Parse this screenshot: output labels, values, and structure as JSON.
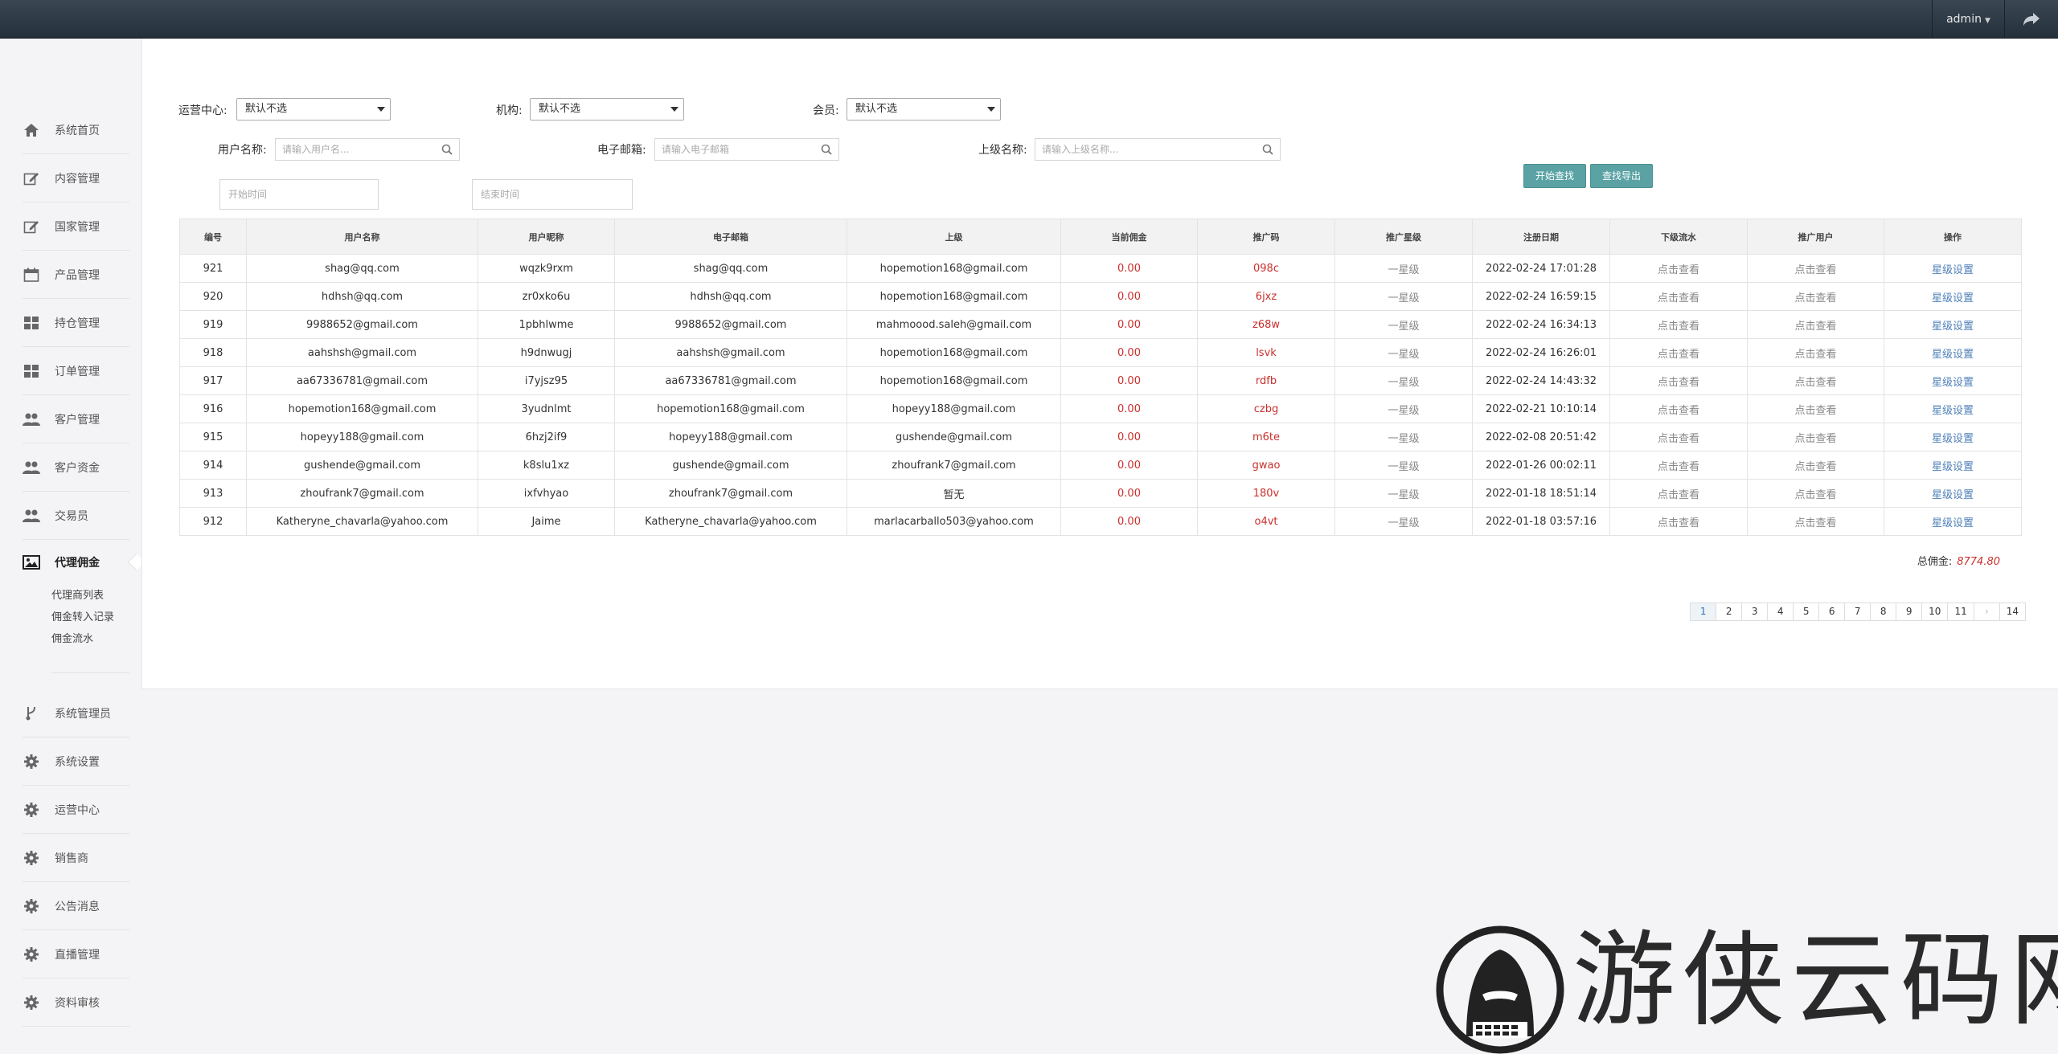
{
  "topbar": {
    "user": "admin"
  },
  "sidebar": {
    "items": [
      {
        "label": "系统首页",
        "icon": "home-icon"
      },
      {
        "label": "内容管理",
        "icon": "edit-icon"
      },
      {
        "label": "国家管理",
        "icon": "edit-icon"
      },
      {
        "label": "产品管理",
        "icon": "calendar-icon"
      },
      {
        "label": "持仓管理",
        "icon": "grid-icon"
      },
      {
        "label": "订单管理",
        "icon": "grid-icon"
      },
      {
        "label": "客户管理",
        "icon": "users-icon"
      },
      {
        "label": "客户资金",
        "icon": "users-icon"
      },
      {
        "label": "交易员",
        "icon": "users-icon"
      },
      {
        "label": "代理佣金",
        "icon": "image-icon"
      }
    ],
    "sub_items": [
      "代理商列表",
      "佣金转入记录",
      "佣金流水"
    ],
    "items_after": [
      {
        "label": "系统管理员",
        "icon": "branch-icon"
      },
      {
        "label": "系统设置",
        "icon": "gear-icon"
      },
      {
        "label": "运营中心",
        "icon": "gear-icon"
      },
      {
        "label": "销售商",
        "icon": "gear-icon"
      },
      {
        "label": "公告消息",
        "icon": "gear-icon"
      },
      {
        "label": "直播管理",
        "icon": "gear-icon"
      },
      {
        "label": "资料审核",
        "icon": "gear-icon"
      }
    ]
  },
  "filters": {
    "center_label": "运营中心:",
    "center_value": "默认不选",
    "org_label": "机构:",
    "org_value": "默认不选",
    "member_label": "会员:",
    "member_value": "默认不选",
    "username_label": "用户名称:",
    "username_placeholder": "请输入用户名...",
    "email_label": "电子邮箱:",
    "email_placeholder": "请输入电子邮箱",
    "parent_label": "上级名称:",
    "parent_placeholder": "请输入上级名称...",
    "start_placeholder": "开始时间",
    "end_placeholder": "结束时间",
    "search_button": "开始查找",
    "export_button": "查找导出"
  },
  "table": {
    "headers": [
      "编号",
      "用户名称",
      "用户昵称",
      "电子邮箱",
      "上级",
      "当前佣金",
      "推广码",
      "推广星级",
      "注册日期",
      "下级流水",
      "推广用户",
      "操作"
    ],
    "rows": [
      [
        "921",
        "shag@qq.com",
        "wqzk9rxm",
        "shag@qq.com",
        "hopemotion168@gmail.com",
        "0.00",
        "098c",
        "一星级",
        "2022-02-24 17:01:28",
        "点击查看",
        "点击查看",
        "星级设置"
      ],
      [
        "920",
        "hdhsh@qq.com",
        "zr0xko6u",
        "hdhsh@qq.com",
        "hopemotion168@gmail.com",
        "0.00",
        "6jxz",
        "一星级",
        "2022-02-24 16:59:15",
        "点击查看",
        "点击查看",
        "星级设置"
      ],
      [
        "919",
        "9988652@gmail.com",
        "1pbhlwme",
        "9988652@gmail.com",
        "mahmoood.saleh@gmail.com",
        "0.00",
        "z68w",
        "一星级",
        "2022-02-24 16:34:13",
        "点击查看",
        "点击查看",
        "星级设置"
      ],
      [
        "918",
        "aahshsh@gmail.com",
        "h9dnwugj",
        "aahshsh@gmail.com",
        "hopemotion168@gmail.com",
        "0.00",
        "lsvk",
        "一星级",
        "2022-02-24 16:26:01",
        "点击查看",
        "点击查看",
        "星级设置"
      ],
      [
        "917",
        "aa67336781@gmail.com",
        "i7yjsz95",
        "aa67336781@gmail.com",
        "hopemotion168@gmail.com",
        "0.00",
        "rdfb",
        "一星级",
        "2022-02-24 14:43:32",
        "点击查看",
        "点击查看",
        "星级设置"
      ],
      [
        "916",
        "hopemotion168@gmail.com",
        "3yudnlmt",
        "hopemotion168@gmail.com",
        "hopeyy188@gmail.com",
        "0.00",
        "czbg",
        "一星级",
        "2022-02-21 10:10:14",
        "点击查看",
        "点击查看",
        "星级设置"
      ],
      [
        "915",
        "hopeyy188@gmail.com",
        "6hzj2if9",
        "hopeyy188@gmail.com",
        "gushende@gmail.com",
        "0.00",
        "m6te",
        "一星级",
        "2022-02-08 20:51:42",
        "点击查看",
        "点击查看",
        "星级设置"
      ],
      [
        "914",
        "gushende@gmail.com",
        "k8slu1xz",
        "gushende@gmail.com",
        "zhoufrank7@gmail.com",
        "0.00",
        "gwao",
        "一星级",
        "2022-01-26 00:02:11",
        "点击查看",
        "点击查看",
        "星级设置"
      ],
      [
        "913",
        "zhoufrank7@gmail.com",
        "ixfvhyao",
        "zhoufrank7@gmail.com",
        "暂无",
        "0.00",
        "180v",
        "一星级",
        "2022-01-18 18:51:14",
        "点击查看",
        "点击查看",
        "星级设置"
      ],
      [
        "912",
        "Katheryne_chavarla@yahoo.com",
        "Jaime",
        "Katheryne_chavarla@yahoo.com",
        "marlacarballo503@yahoo.com",
        "0.00",
        "o4vt",
        "一星级",
        "2022-01-18 03:57:16",
        "点击查看",
        "点击查看",
        "星级设置"
      ]
    ]
  },
  "total": {
    "label": "总佣金:",
    "value": "8774.80"
  },
  "pagination": [
    "1",
    "2",
    "3",
    "4",
    "5",
    "6",
    "7",
    "8",
    "9",
    "10",
    "11",
    "›",
    "14"
  ],
  "watermark": {
    "text": "游侠云码网"
  },
  "colors": {
    "accent_button": "#5aa2a4",
    "value_red": "#c9302c",
    "link_blue": "#4f80b8",
    "topbar": "#2b3640"
  }
}
